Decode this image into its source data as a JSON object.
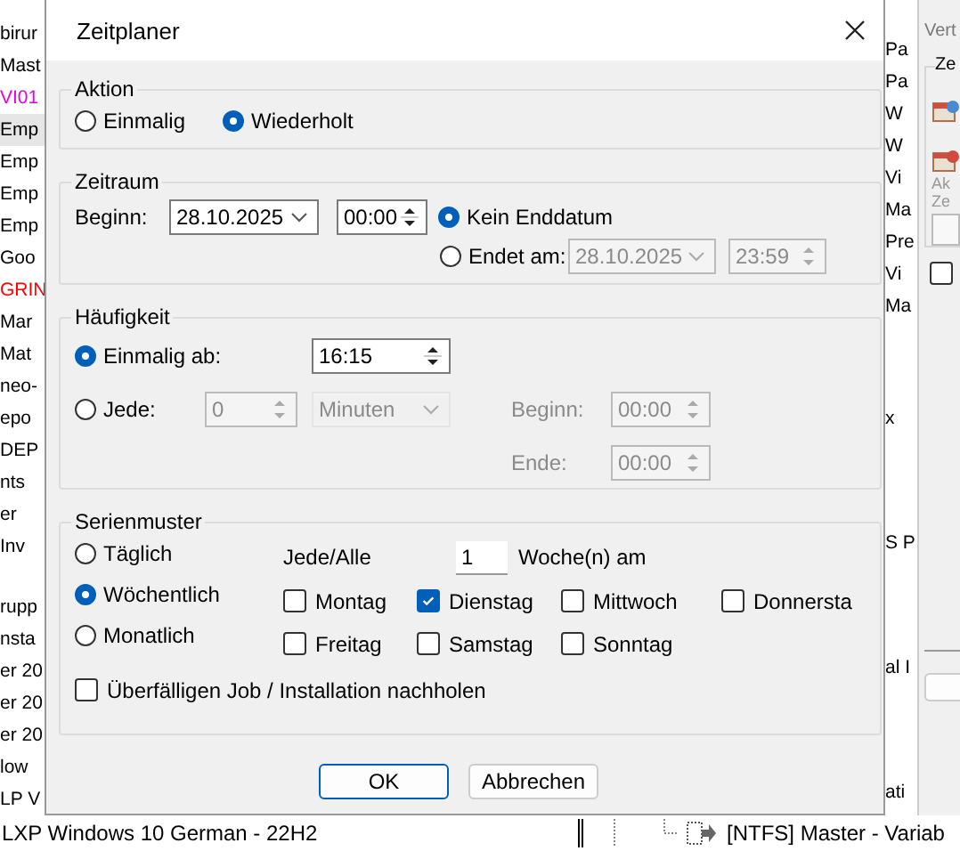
{
  "background": {
    "left_list": [
      {
        "text": "birur",
        "selected": false,
        "color": "#000000"
      },
      {
        "text": "Mast",
        "selected": false,
        "color": "#000000"
      },
      {
        "text": "VI01",
        "selected": false,
        "color": "#e000e0"
      },
      {
        "text": "Emp",
        "selected": true,
        "color": "#000000"
      },
      {
        "text": "Emp",
        "selected": false,
        "color": "#000000"
      },
      {
        "text": "Emp",
        "selected": false,
        "color": "#000000"
      },
      {
        "text": "Emp",
        "selected": false,
        "color": "#000000"
      },
      {
        "text": "Goo",
        "selected": false,
        "color": "#000000"
      },
      {
        "text": "GRIN",
        "selected": false,
        "color": "#ff0000"
      },
      {
        "text": "Mar",
        "selected": false,
        "color": "#000000"
      },
      {
        "text": "Mat",
        "selected": false,
        "color": "#000000"
      },
      {
        "text": "neo-",
        "selected": false,
        "color": "#000000"
      },
      {
        "text": "epo",
        "selected": false,
        "color": "#000000"
      },
      {
        "text": "DEP",
        "selected": false,
        "color": "#000000"
      },
      {
        "text": "nts",
        "selected": false,
        "color": "#000000"
      },
      {
        "text": "er",
        "selected": false,
        "color": "#000000"
      },
      {
        "text": "Inv",
        "selected": false,
        "color": "#000000"
      }
    ],
    "left_list_lower": [
      {
        "text": "rupp",
        "selected": false,
        "color": "#000000"
      },
      {
        "text": "nsta",
        "selected": false,
        "color": "#000000"
      },
      {
        "text": "er 20",
        "selected": false,
        "color": "#000000"
      },
      {
        "text": "er 20",
        "selected": false,
        "color": "#000000"
      },
      {
        "text": "er 20",
        "selected": false,
        "color": "#000000"
      },
      {
        "text": "low",
        "selected": false,
        "color": "#000000"
      },
      {
        "text": "LP V",
        "selected": false,
        "color": "#000000"
      }
    ],
    "right_list": [
      "Pa",
      "Pa",
      "W",
      "W",
      "Vi",
      "Ma",
      "Pre",
      "Vi",
      "Ma"
    ],
    "right_list_lower": [
      "x",
      "S P",
      "al I",
      "ati"
    ],
    "right_dialog": {
      "title": "Vert",
      "group": "Ze",
      "labels": [
        "Ak",
        "Ze"
      ],
      "checked": false
    },
    "status_line": {
      "left": "LXP Windows 10 German - 22H2",
      "right": "[NTFS] Master - Variab"
    }
  },
  "dialog": {
    "title": "Zeitplaner",
    "aktion": {
      "label": "Aktion",
      "options": [
        {
          "label": "Einmalig",
          "selected": false
        },
        {
          "label": "Wiederholt",
          "selected": true
        }
      ]
    },
    "zeitraum": {
      "label": "Zeitraum",
      "start_label": "Beginn:",
      "start_date": "28.10.2025",
      "start_time": "00:00",
      "end_options": [
        {
          "label": "Kein Enddatum",
          "selected": true
        },
        {
          "label": "Endet am:",
          "selected": false
        }
      ],
      "end_date": "28.10.2025",
      "end_time": "23:59"
    },
    "haeufigkeit": {
      "label": "Häufigkeit",
      "options": [
        {
          "label": "Einmalig ab:",
          "selected": true
        },
        {
          "label": "Jede:",
          "selected": false
        }
      ],
      "once_time": "16:15",
      "interval_value": "0",
      "interval_unit": "Minuten",
      "start_label": "Beginn:",
      "start_time": "00:00",
      "end_label": "Ende:",
      "end_time": "00:00"
    },
    "serienmuster": {
      "label": "Serienmuster",
      "patterns": [
        {
          "label": "Täglich",
          "selected": false
        },
        {
          "label": "Wöchentlich",
          "selected": true
        },
        {
          "label": "Monatlich",
          "selected": false
        }
      ],
      "every_label": "Jede/Alle",
      "every_value": "1",
      "every_unit": "Woche(n) am",
      "days": [
        {
          "label": "Montag",
          "checked": false
        },
        {
          "label": "Dienstag",
          "checked": true
        },
        {
          "label": "Mittwoch",
          "checked": false
        },
        {
          "label": "Donnersta",
          "checked": false
        },
        {
          "label": "Freitag",
          "checked": false
        },
        {
          "label": "Samstag",
          "checked": false
        },
        {
          "label": "Sonntag",
          "checked": false
        }
      ],
      "catch_up": {
        "label": "Überfälligen Job / Installation nachholen",
        "checked": false
      }
    },
    "buttons": [
      {
        "label": "OK",
        "default": true
      },
      {
        "label": "Abbrechen",
        "default": false
      }
    ]
  }
}
